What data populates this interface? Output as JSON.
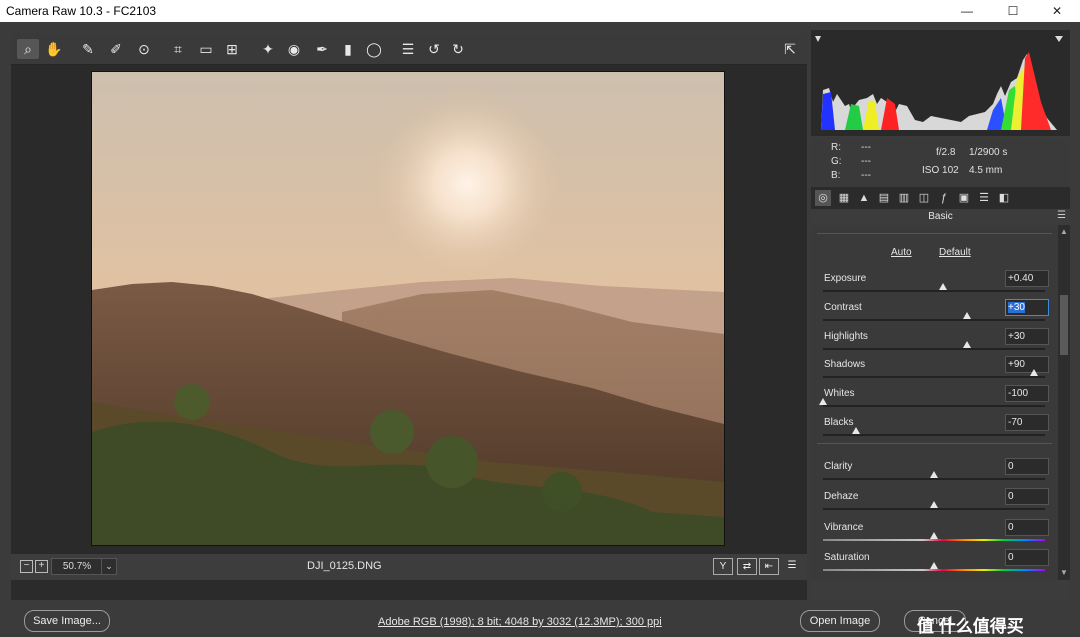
{
  "window": {
    "title": "Camera Raw 10.3  -  FC2103",
    "minimize": "—",
    "maximize": "☐",
    "close": "✕"
  },
  "toolbar": {
    "icons": [
      "zoom-tool",
      "hand-tool",
      "white-balance-tool",
      "color-sampler-tool",
      "targeted-adjustment-tool",
      "crop-tool",
      "straighten-tool",
      "transform-tool",
      "spot-removal-tool",
      "red-eye-tool",
      "adjustment-brush",
      "graduated-filter",
      "radial-filter",
      "preferences",
      "rotate-ccw",
      "rotate-cw",
      "toggle-fullscreen"
    ]
  },
  "status": {
    "zoom": "50.7%",
    "filename": "DJI_0125.DNG",
    "view_y": "Y"
  },
  "exif": {
    "r_label": "R:",
    "g_label": "G:",
    "b_label": "B:",
    "r": "---",
    "g": "---",
    "b": "---",
    "aperture": "f/2.8",
    "shutter": "1/2900 s",
    "iso": "ISO 102",
    "focal": "4.5 mm"
  },
  "panel": {
    "title": "Basic",
    "auto": "Auto",
    "default": "Default",
    "sliders": [
      {
        "label": "Exposure",
        "value": "+0.40",
        "pos": 0.54
      },
      {
        "label": "Contrast",
        "value": "+30",
        "pos": 0.65,
        "selected": true
      },
      {
        "label": "Highlights",
        "value": "+30",
        "pos": 0.65
      },
      {
        "label": "Shadows",
        "value": "+90",
        "pos": 0.95
      },
      {
        "label": "Whites",
        "value": "-100",
        "pos": 0.0
      },
      {
        "label": "Blacks",
        "value": "-70",
        "pos": 0.15
      },
      {
        "label": "Clarity",
        "value": "0",
        "pos": 0.5
      },
      {
        "label": "Dehaze",
        "value": "0",
        "pos": 0.5
      },
      {
        "label": "Vibrance",
        "value": "0",
        "pos": 0.5
      },
      {
        "label": "Saturation",
        "value": "0",
        "pos": 0.5
      }
    ]
  },
  "footer": {
    "save": "Save Image...",
    "workflow": "Adobe RGB (1998); 8 bit; 4048 by 3032 (12.3MP); 300 ppi",
    "open": "Open Image",
    "cancel": "Cancel",
    "watermark": "值 什么值得买"
  }
}
